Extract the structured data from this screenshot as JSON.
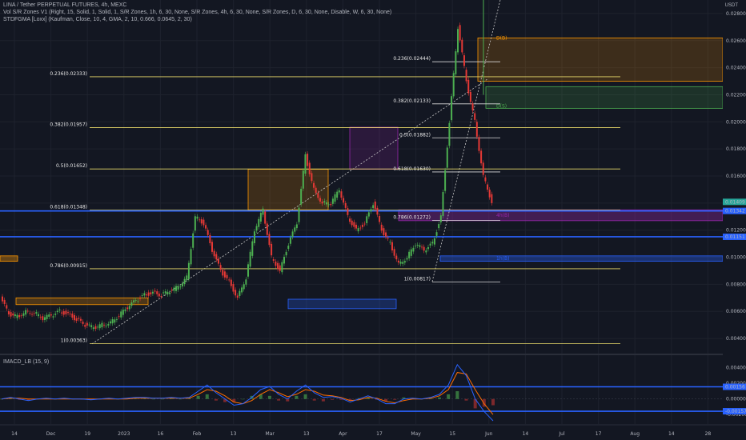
{
  "header": {
    "symbol_line": "LINA / Tether PERPETUAL FUTURES, 4h, MEXC",
    "indicator_1": "Vol S/R Zones V1 (Right, 15, Solid, 1, Solid, 1, S/R Zones, 1h, 6, 30, None, S/R Zones, 4h, 6, 30, None, S/R Zones, D, 6, 30, None, Disable, W, 6, 30, None)",
    "indicator_2": "STDFGMA [Loxx] (Kaufman, Close, 10, 4, GMA, 2, 10, 0.666, 0.0645, 2, 30)",
    "lower_pane_title": "IMACD_LB (15, 9)",
    "currency": "USDT"
  },
  "colors": {
    "background": "#131722",
    "fib_line": "#e8d96a",
    "sr_blue": "#2962ff",
    "up_candle": "#4caf50",
    "down_candle": "#e53935",
    "price_badge": "#26a69a"
  },
  "chart_data": [
    {
      "type": "candlestick",
      "title": "",
      "price_axis_ticks": [
        "0.02800",
        "0.02600",
        "0.02400",
        "0.02200",
        "0.02000",
        "0.01800",
        "0.01600",
        "0.01400",
        "0.01200",
        "0.01000",
        "0.00800",
        "0.00600",
        "0.00400"
      ],
      "price_axis_values": [
        0.028,
        0.026,
        0.024,
        0.022,
        0.02,
        0.018,
        0.016,
        0.014,
        0.012,
        0.01,
        0.008,
        0.006,
        0.004
      ],
      "ylim": [
        0.003,
        0.029
      ],
      "current_price": "0.01409",
      "sr_labels": [
        "0.01342",
        "0.01151"
      ],
      "sr_values": [
        0.01342,
        0.01151
      ],
      "x_ticks": [
        "14",
        "Dec",
        "19",
        "2023",
        "16",
        "Feb",
        "13",
        "Mar",
        "13",
        "Apr",
        "17",
        "May",
        "15",
        "Jun",
        "14",
        "Jul",
        "17",
        "Aug",
        "14",
        "28"
      ],
      "fib_left": [
        {
          "label": "0.236(0.02333)",
          "value": 0.02333
        },
        {
          "label": "0.382(0.01957)",
          "value": 0.01957
        },
        {
          "label": "0.5(0.01652)",
          "value": 0.01652
        },
        {
          "label": "0.618(0.01348)",
          "value": 0.01348
        },
        {
          "label": "0.786(0.00915)",
          "value": 0.00915
        },
        {
          "label": "1(0.00363)",
          "value": 0.00363
        }
      ],
      "fib_right": [
        {
          "label": "0.236(0.02444)",
          "value": 0.02444
        },
        {
          "label": "0.382(0.02133)",
          "value": 0.02133
        },
        {
          "label": "0.5(0.01882)",
          "value": 0.01882
        },
        {
          "label": "0.618(0.01630)",
          "value": 0.0163
        },
        {
          "label": "0.786(0.01272)",
          "value": 0.01272
        },
        {
          "label": "1(0.00817)",
          "value": 0.00817
        }
      ],
      "zone_labels": [
        "D(B)",
        "D(S)",
        "4h(B)",
        "1h(B)"
      ],
      "close_path": [
        0.007,
        0.0058,
        0.0056,
        0.006,
        0.0059,
        0.0055,
        0.0057,
        0.006,
        0.0058,
        0.0054,
        0.005,
        0.0048,
        0.005,
        0.0052,
        0.0057,
        0.0063,
        0.0068,
        0.0072,
        0.0074,
        0.0072,
        0.0075,
        0.0078,
        0.0085,
        0.013,
        0.0125,
        0.0105,
        0.009,
        0.0082,
        0.007,
        0.0085,
        0.012,
        0.0135,
        0.01,
        0.009,
        0.011,
        0.0125,
        0.0175,
        0.015,
        0.014,
        0.014,
        0.015,
        0.013,
        0.012,
        0.0125,
        0.014,
        0.012,
        0.011,
        0.0095,
        0.01,
        0.011,
        0.0105,
        0.011,
        0.013,
        0.02,
        0.027,
        0.023,
        0.02,
        0.016,
        0.0141
      ]
    },
    {
      "type": "line",
      "title": "IMACD_LB (15, 9)",
      "axis_ticks": [
        "0.00400",
        "0.00200",
        "0.00000",
        "-0.00200"
      ],
      "axis_values": [
        0.004,
        0.002,
        0.0,
        -0.002
      ],
      "level_labels": [
        "0.00156",
        "-0.00157"
      ],
      "level_values": [
        0.00156,
        -0.00157
      ],
      "ylim": [
        -0.003,
        0.0052
      ],
      "series": [
        {
          "values": [
            0.0,
            0.0002,
            0.0,
            -0.0002,
            0.0,
            0.0001,
            0.0,
            0.0001,
            0.0,
            0.0,
            -0.0001,
            0.0,
            0.0001,
            0.0,
            0.0001,
            0.0002,
            0.0002,
            0.0001,
            0.0001,
            0.0002,
            0.0001,
            0.0002,
            0.001,
            0.0018,
            0.0008,
            0.0,
            -0.0008,
            -0.0006,
            0.0002,
            0.0012,
            0.0016,
            0.0006,
            0.0,
            0.001,
            0.0018,
            0.0008,
            0.0002,
            0.0003,
            0.0001,
            -0.0004,
            0.0,
            0.0004,
            0.0,
            -0.0006,
            -0.0006,
            0.0,
            0.0001,
            0.0,
            0.0002,
            0.0006,
            0.0018,
            0.0044,
            0.003,
            0.0,
            -0.0016,
            -0.0028
          ]
        },
        {
          "values": [
            0.0,
            0.0001,
            0.0001,
            0.0,
            0.0,
            0.0,
            0.0,
            0.0,
            0.0,
            0.0,
            0.0,
            0.0,
            0.0,
            0.0,
            0.0,
            0.0001,
            0.0001,
            0.0001,
            0.0001,
            0.0001,
            0.0001,
            0.0001,
            0.0006,
            0.0012,
            0.001,
            0.0004,
            -0.0004,
            -0.0006,
            -0.0002,
            0.0006,
            0.0012,
            0.0008,
            0.0003,
            0.0006,
            0.0012,
            0.001,
            0.0005,
            0.0004,
            0.0002,
            -0.0002,
            -0.0001,
            0.0002,
            0.0001,
            -0.0003,
            -0.0005,
            -0.0002,
            0.0,
            0.0,
            0.0001,
            0.0004,
            0.0012,
            0.0034,
            0.0032,
            0.0012,
            -0.0006,
            -0.002
          ]
        }
      ]
    }
  ]
}
